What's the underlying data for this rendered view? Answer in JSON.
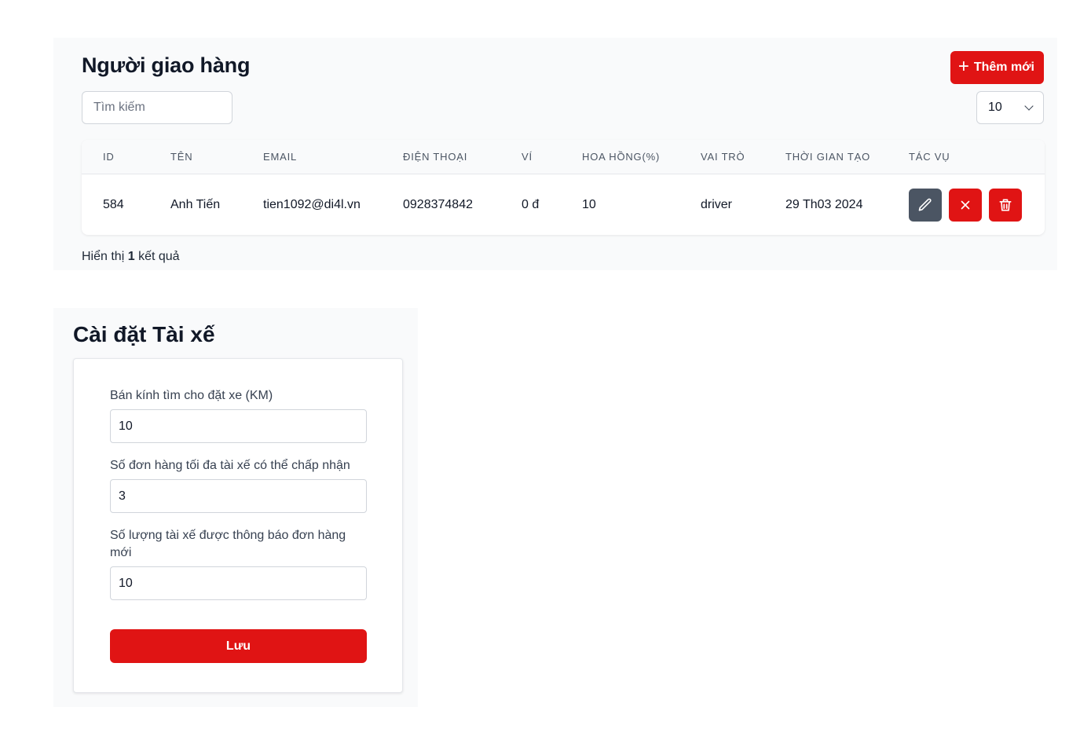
{
  "drivers": {
    "title": "Người giao hàng",
    "add_button_label": "Thêm mới",
    "search_placeholder": "Tìm kiếm",
    "page_size": "10",
    "columns": {
      "id": "ID",
      "name": "TÊN",
      "email": "EMAIL",
      "phone": "ĐIỆN THOẠI",
      "wallet": "VÍ",
      "commission": "HOA HỒNG(%)",
      "role": "VAI TRÒ",
      "created_at": "THỜI GIAN TẠO",
      "actions": "TÁC VỤ"
    },
    "rows": [
      {
        "id": "584",
        "name": "Anh Tiến",
        "email": "tien1092@di4l.vn",
        "phone": "0928374842",
        "wallet": "0 đ",
        "commission": "10",
        "role": "driver",
        "created_at": "29 Th03 2024"
      }
    ],
    "results_prefix": "Hiển thị",
    "results_count": "1",
    "results_suffix": "kết quả",
    "colors": {
      "primary_red": "#e01414",
      "edit_gray": "#4b5563"
    }
  },
  "settings": {
    "title": "Cài đặt Tài xế",
    "fields": [
      {
        "label": "Bán kính tìm cho đặt xe (KM)",
        "value": "10"
      },
      {
        "label": "Số đơn hàng tối đa tài xế có thể chấp nhận",
        "value": "3"
      },
      {
        "label": "Số lượng tài xế được thông báo đơn hàng mới",
        "value": "10"
      }
    ],
    "save_label": "Lưu"
  },
  "icons": {
    "add": "plus-icon",
    "edit": "pencil-icon",
    "ban": "close-icon",
    "delete": "trash-icon",
    "select": "chevron-down-icon"
  }
}
